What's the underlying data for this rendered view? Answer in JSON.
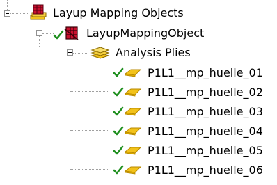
{
  "tree": {
    "root": {
      "label": "Layup Mapping Objects",
      "icon": "layup-mapping-objects-icon"
    },
    "mapping_object": {
      "label": "LayupMappingObject",
      "icon": "layup-mapping-object-icon",
      "status": "checked"
    },
    "analysis_plies": {
      "label": "Analysis Plies",
      "icon": "analysis-plies-stack-icon"
    },
    "plies": [
      {
        "label": "P1L1__mp_huelle_01",
        "status": "checked"
      },
      {
        "label": "P1L1__mp_huelle_02",
        "status": "checked"
      },
      {
        "label": "P1L1__mp_huelle_03",
        "status": "checked"
      },
      {
        "label": "P1L1__mp_huelle_04",
        "status": "checked"
      },
      {
        "label": "P1L1__mp_huelle_05",
        "status": "checked"
      },
      {
        "label": "P1L1__mp_huelle_06",
        "status": "checked"
      }
    ]
  },
  "colors": {
    "check": "#1f8f1f",
    "ply_fill": "#f2c21a",
    "ply_edge": "#b88a00",
    "lines": "#a0a0a0",
    "red": "#c8102e"
  }
}
